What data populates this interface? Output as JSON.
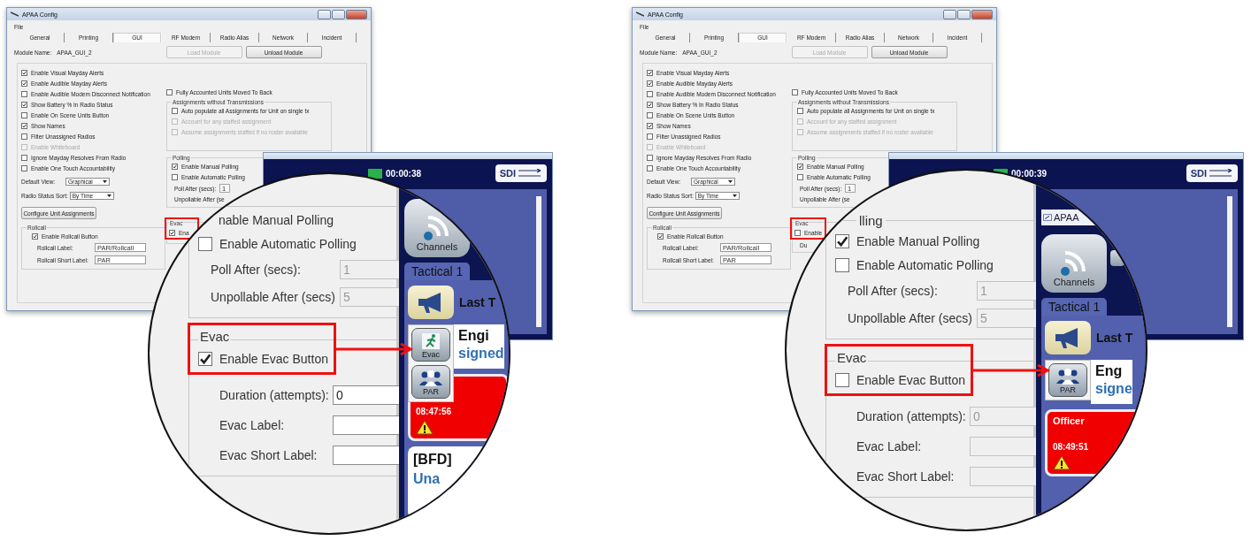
{
  "panels": [
    {
      "config": {
        "title": "APAA Config",
        "menu": [
          "File"
        ],
        "tabs": [
          {
            "label": "General",
            "selected": false
          },
          {
            "label": "Printing",
            "selected": false
          },
          {
            "label": "GUI",
            "selected": true
          },
          {
            "label": "RF Modem",
            "selected": false
          },
          {
            "label": "Radio Alias",
            "selected": false
          },
          {
            "label": "Network",
            "selected": false
          },
          {
            "label": "Incident",
            "selected": false
          }
        ],
        "module_label": "Module Name:",
        "module_name": "APAA_GUI_2",
        "buttons": [
          {
            "label": "Load Module",
            "disabled": true
          },
          {
            "label": "Unload Module",
            "disabled": false
          }
        ],
        "options": [
          {
            "label": "Enable Visual Mayday Alerts",
            "checked": true,
            "disabled": false
          },
          {
            "label": "Enable Audible Mayday Alerts",
            "checked": true,
            "disabled": false
          },
          {
            "label": "Enable Audible Modem Disconnect Notification",
            "checked": false,
            "disabled": false
          },
          {
            "label": "Show Battery % In Radio Status",
            "checked": true,
            "disabled": false
          },
          {
            "label": "Enable On Scene Units Button",
            "checked": false,
            "disabled": false
          },
          {
            "label": "Show Names",
            "checked": true,
            "disabled": false
          },
          {
            "label": "Filter Unassigned Radios",
            "checked": false,
            "disabled": false
          },
          {
            "label": "Enable Whiteboard",
            "checked": false,
            "disabled": true
          },
          {
            "label": "Ignore Mayday Resolves From Radio",
            "checked": false,
            "disabled": false
          },
          {
            "label": "Enable One Touch Accountability",
            "checked": false,
            "disabled": false
          }
        ],
        "selects": [
          {
            "label": "Default View:",
            "value": "Graphical"
          },
          {
            "label": "Radio Status Sort:",
            "value": "By Time"
          }
        ],
        "configure_button": "Configure Unit Assignments",
        "rollcall": {
          "title": "Rollcall",
          "enable": {
            "label": "Enable Rollcall Button",
            "checked": true
          },
          "fields": [
            {
              "label": "Rollcall Label:",
              "value": "PAR/Rollcall"
            },
            {
              "label": "Rollcall Short Label:",
              "value": "PAR"
            }
          ]
        },
        "fully_accounted": {
          "label": "Fully Accounted Units Moved To Back",
          "checked": false
        },
        "assignments": {
          "title": "Assignments without Transmissions",
          "options": [
            {
              "label": "Auto populate all Assignments for Unit on single tx",
              "checked": false,
              "disabled": false
            },
            {
              "label": "Account for any staffed assignment",
              "checked": false,
              "disabled": true
            },
            {
              "label": "Assume assignments staffed if no roster available",
              "checked": false,
              "disabled": true
            }
          ]
        },
        "polling": {
          "title": "Polling",
          "options": [
            {
              "label": "Enable Manual Polling",
              "checked": true
            },
            {
              "label": "Enable Automatic Polling",
              "checked": false
            }
          ],
          "fields": [
            {
              "label": "Poll After (secs):",
              "value": "1"
            },
            {
              "label": "Unpollable After (se"
            }
          ]
        },
        "evac": {
          "title": "Evac",
          "enable": {
            "label": "Ena",
            "checked": true
          }
        }
      },
      "app": {
        "timer": "00:00:38",
        "logo": "SDI"
      },
      "magnifier": {
        "polling": {
          "options": [
            {
              "label": "nable Manual Polling"
            },
            {
              "label": "Enable Automatic Polling",
              "checked": false
            }
          ],
          "fields": [
            {
              "label": "Poll After (secs):",
              "value": "1",
              "disabled": true
            },
            {
              "label": "Unpollable After (secs)",
              "value": "5",
              "disabled": true
            }
          ]
        },
        "evac": {
          "title": "Evac",
          "enable": {
            "label": "Enable Evac Button",
            "checked": true
          },
          "fields": [
            {
              "label": "Duration (attempts):",
              "value": "0",
              "disabled": false
            },
            {
              "label": "Evac Label:",
              "disabled": false
            },
            {
              "label": "Evac Short Label:",
              "disabled": false
            }
          ]
        },
        "app": {
          "channels": "Channels",
          "tab": "Tactical 1",
          "last": "Last T",
          "buttons": [
            {
              "kind": "evac",
              "label": "Evac"
            },
            {
              "kind": "par",
              "label": "PAR"
            }
          ],
          "unit": "Engi",
          "status": "signed",
          "alert": {
            "time": "08:47:56"
          },
          "next": {
            "unit": "[BFD]",
            "status": "Una"
          }
        }
      }
    },
    {
      "config": {
        "title": "APAA Config",
        "menu": [
          "File"
        ],
        "tabs": [
          {
            "label": "General",
            "selected": false
          },
          {
            "label": "Printing",
            "selected": false
          },
          {
            "label": "GUI",
            "selected": true
          },
          {
            "label": "RF Modem",
            "selected": false
          },
          {
            "label": "Radio Alias",
            "selected": false
          },
          {
            "label": "Network",
            "selected": false
          },
          {
            "label": "Incident",
            "selected": false
          }
        ],
        "module_label": "Module Name:",
        "module_name": "APAA_GUI_2",
        "buttons": [
          {
            "label": "Load Module",
            "disabled": true
          },
          {
            "label": "Unload Module",
            "disabled": false
          }
        ],
        "options": [
          {
            "label": "Enable Visual Mayday Alerts",
            "checked": true,
            "disabled": false
          },
          {
            "label": "Enable Audible Mayday Alerts",
            "checked": true,
            "disabled": false
          },
          {
            "label": "Enable Audible Modem Disconnect Notification",
            "checked": false,
            "disabled": false
          },
          {
            "label": "Show Battery % In Radio Status",
            "checked": true,
            "disabled": false
          },
          {
            "label": "Enable On Scene Units Button",
            "checked": false,
            "disabled": false
          },
          {
            "label": "Show Names",
            "checked": true,
            "disabled": false
          },
          {
            "label": "Filter Unassigned Radios",
            "checked": false,
            "disabled": false
          },
          {
            "label": "Enable Whiteboard",
            "checked": false,
            "disabled": true
          },
          {
            "label": "Ignore Mayday Resolves From Radio",
            "checked": false,
            "disabled": false
          },
          {
            "label": "Enable One Touch Accountability",
            "checked": false,
            "disabled": false
          }
        ],
        "selects": [
          {
            "label": "Default View:",
            "value": "Graphical"
          },
          {
            "label": "Radio Status Sort:",
            "value": "By Time"
          }
        ],
        "configure_button": "Configure Unit Assignments",
        "rollcall": {
          "title": "Rollcall",
          "enable": {
            "label": "Enable Rollcall Button",
            "checked": true
          },
          "fields": [
            {
              "label": "Rollcall Label:",
              "value": "PAR/Rollcall"
            },
            {
              "label": "Rollcall Short Label:",
              "value": "PAR"
            }
          ]
        },
        "fully_accounted": {
          "label": "Fully Accounted Units Moved To Back",
          "checked": false
        },
        "assignments": {
          "title": "Assignments without Transmissions",
          "options": [
            {
              "label": "Auto populate all Assignments for Unit on single tx",
              "checked": false,
              "disabled": false
            },
            {
              "label": "Account for any staffed assignment",
              "checked": false,
              "disabled": true
            },
            {
              "label": "Assume assignments staffed if no roster available",
              "checked": false,
              "disabled": true
            }
          ]
        },
        "polling": {
          "title": "Polling",
          "options": [
            {
              "label": "Enable Manual Polling",
              "checked": true
            },
            {
              "label": "Enable Automatic Polling",
              "checked": false
            }
          ],
          "fields": [
            {
              "label": "Poll After (secs):",
              "value": "1"
            },
            {
              "label": "Unpollable After (se"
            }
          ]
        },
        "evac": {
          "title": "Evac",
          "enable": {
            "label": "Enable",
            "checked": false
          },
          "fields": [
            {
              "label": "Du"
            }
          ]
        }
      },
      "app": {
        "timer": "00:00:39",
        "logo": "SDI"
      },
      "magnifier": {
        "polling": {
          "title": "lling",
          "options": [
            {
              "label": "Enable Manual Polling",
              "checked": true
            },
            {
              "label": "Enable Automatic Polling",
              "checked": false
            }
          ],
          "fields": [
            {
              "label": "Poll After (secs):",
              "value": "1",
              "disabled": true
            },
            {
              "label": "Unpollable After (secs)",
              "value": "5",
              "disabled": true
            }
          ]
        },
        "evac": {
          "title": "Evac",
          "enable": {
            "label": "Enable Evac Button",
            "checked": false
          },
          "fields": [
            {
              "label": "Duration (attempts):",
              "value": "0",
              "disabled": true
            },
            {
              "label": "Evac Label:",
              "disabled": true
            },
            {
              "label": "Evac Short Label:",
              "disabled": true
            }
          ]
        },
        "app": {
          "window_title": "APAA",
          "channels": "Channels",
          "tab": "Tactical 1",
          "last": "Last T",
          "buttons": [
            {
              "kind": "par",
              "label": "PAR"
            }
          ],
          "unit": "Eng",
          "status": "signe",
          "alert": {
            "title": "Officer",
            "time": "08:49:51"
          }
        }
      }
    }
  ]
}
